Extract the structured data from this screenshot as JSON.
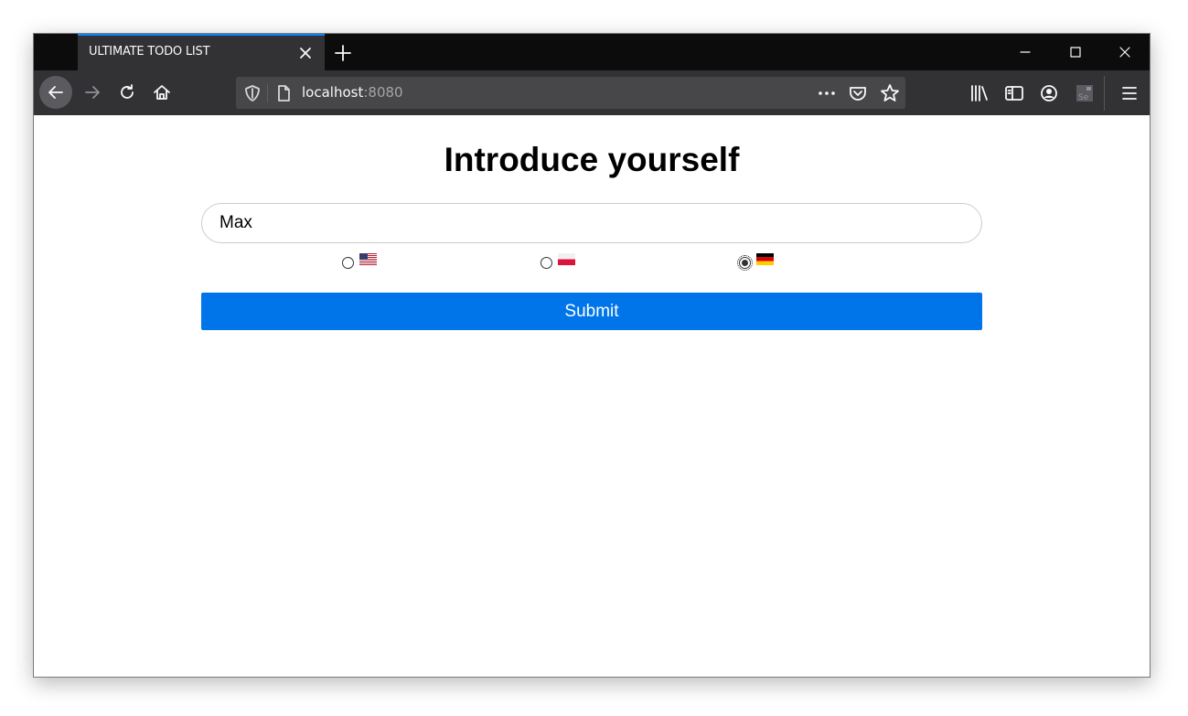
{
  "browser": {
    "tab_title": "ULTIMATE TODO LIST",
    "url_host": "localhost",
    "url_port": ":8080",
    "accent_color": "#0a84ff",
    "icons": [
      "back-arrow-icon",
      "forward-arrow-icon",
      "reload-icon",
      "home-icon",
      "tracking-shield-icon",
      "page-icon",
      "more-actions-icon",
      "pocket-icon",
      "bookmark-star-icon",
      "library-icon",
      "sidebar-icon",
      "account-icon",
      "selenium-extension-icon",
      "hamburger-menu-icon",
      "minimize-icon",
      "maximize-icon",
      "close-window-icon",
      "new-tab-icon"
    ]
  },
  "page": {
    "heading": "Introduce yourself",
    "name_value": "Max",
    "languages": [
      {
        "flag": "us-flag-icon",
        "checked": false
      },
      {
        "flag": "poland-flag-icon",
        "checked": false
      },
      {
        "flag": "germany-flag-icon",
        "checked": true
      }
    ],
    "submit_label": "Submit",
    "submit_color": "#0075ea"
  }
}
